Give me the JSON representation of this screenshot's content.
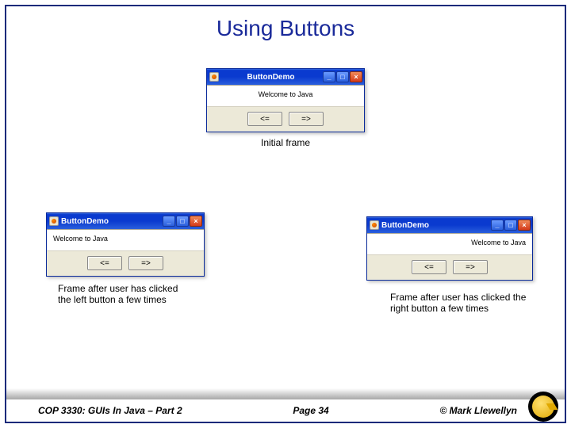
{
  "title": "Using Buttons",
  "windows": {
    "top": {
      "title": "ButtonDemo",
      "message": "Welcome to Java",
      "left_btn": "<=",
      "right_btn": "=>",
      "caption": "Initial frame"
    },
    "left": {
      "title": "ButtonDemo",
      "message": "Welcome to Java",
      "left_btn": "<=",
      "right_btn": "=>",
      "caption": "Frame after user has clicked the left button a few times"
    },
    "right": {
      "title": "ButtonDemo",
      "message": "Welcome to Java",
      "left_btn": "<=",
      "right_btn": "=>",
      "caption": "Frame after user has clicked the right button a few times"
    }
  },
  "footer": {
    "course": "COP 3330:  GUIs In Java – Part 2",
    "page": "Page 34",
    "copyright": "© Mark Llewellyn"
  },
  "win_controls": {
    "min": "_",
    "max": "□",
    "close": "×"
  }
}
